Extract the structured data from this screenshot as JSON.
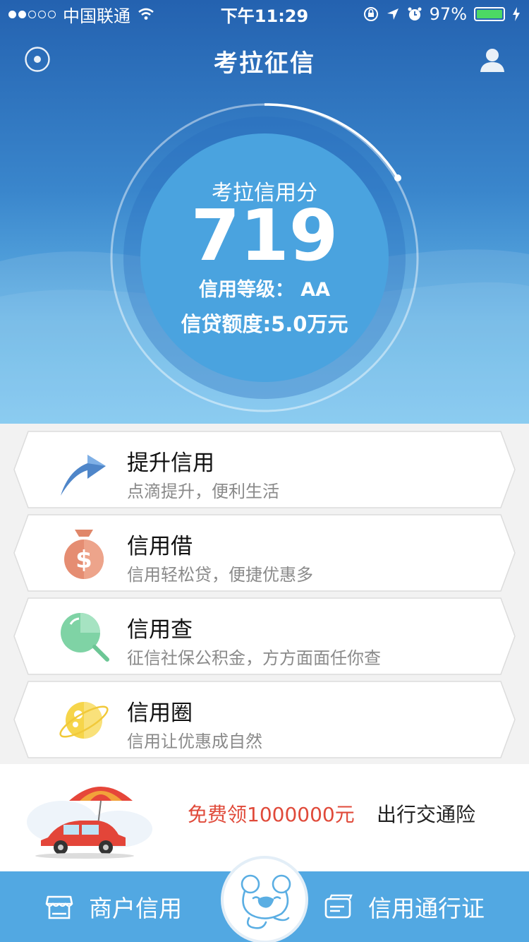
{
  "status_bar": {
    "signal_dots_filled": 2,
    "signal_dots_total": 5,
    "carrier": "中国联通",
    "time": "下午11:29",
    "battery": "97%",
    "icons": [
      "wifi-icon",
      "orientation-lock-icon",
      "location-icon",
      "alarm-icon",
      "battery-icon",
      "charging-icon"
    ]
  },
  "nav": {
    "title": "考拉征信",
    "left_icon": "record-icon",
    "right_icon": "user-icon"
  },
  "score": {
    "label": "考拉信用分",
    "value": "719",
    "grade": "信用等级：  AA",
    "quota": "信贷额度:5.0万元"
  },
  "cards": [
    {
      "title": "提升信用",
      "subtitle": "点滴提升，便利生活",
      "icon": "arrow-up-icon"
    },
    {
      "title": "信用借",
      "subtitle": "信用轻松贷，便捷优惠多",
      "icon": "money-bag-icon"
    },
    {
      "title": "信用查",
      "subtitle": "征信社保公积金，方方面面任你查",
      "icon": "magnifier-icon"
    },
    {
      "title": "信用圈",
      "subtitle": "信用让优惠成自然",
      "icon": "planet-icon"
    }
  ],
  "promo": {
    "highlight": "免费领1000000元",
    "text": "出行交通险",
    "highlight_color": "#e04a3a"
  },
  "tabbar": {
    "left": {
      "label": "商户信用",
      "icon": "store-icon"
    },
    "center": {
      "icon": "koala-logo-icon"
    },
    "right": {
      "label": "信用通行证",
      "icon": "card-icon"
    }
  },
  "colors": {
    "hero_top": "#2462b0",
    "hero_bottom": "#74c2ee",
    "tabbar": "#52a8e2"
  }
}
